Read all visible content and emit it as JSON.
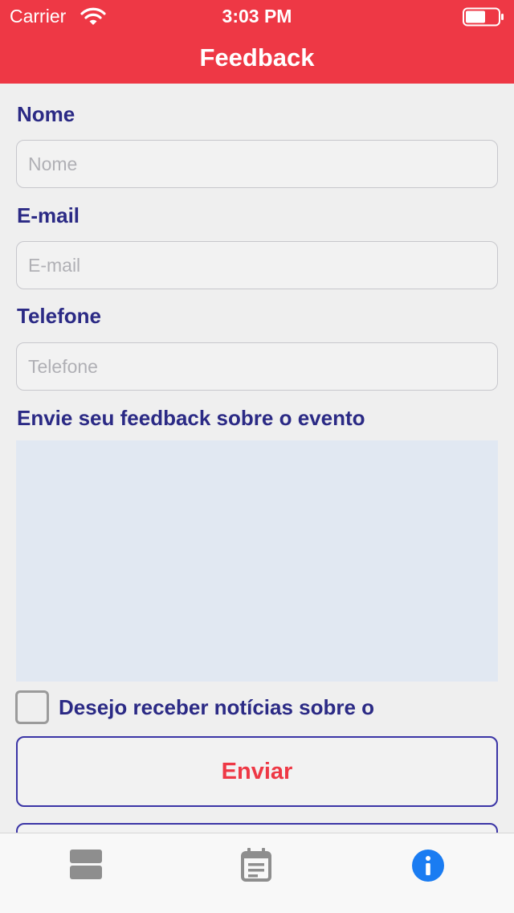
{
  "status_bar": {
    "carrier": "Carrier",
    "time": "3:03 PM",
    "wifi_icon": "wifi-icon",
    "battery_icon": "battery-icon"
  },
  "nav": {
    "title": "Feedback"
  },
  "form": {
    "name": {
      "label": "Nome",
      "placeholder": "Nome",
      "value": ""
    },
    "email": {
      "label": "E-mail",
      "placeholder": "E-mail",
      "value": ""
    },
    "phone": {
      "label": "Telefone",
      "placeholder": "Telefone",
      "value": ""
    },
    "feedback": {
      "label": "Envie seu feedback sobre o evento",
      "value": ""
    },
    "newsletter": {
      "label": "Desejo receber notícias sobre o",
      "checked": false
    },
    "submit_label": "Enviar"
  },
  "tab_bar": {
    "tabs": [
      {
        "icon": "list-icon",
        "active": false
      },
      {
        "icon": "calendar-icon",
        "active": false
      },
      {
        "icon": "info-icon",
        "active": true
      }
    ]
  },
  "colors": {
    "header_bg": "#ee3845",
    "label_text": "#2b2a85",
    "button_border": "#3b35a6",
    "button_text": "#ee3845",
    "textarea_bg": "#e1e8f2",
    "tab_active": "#1a7cf2",
    "tab_inactive": "#8e8e8e"
  }
}
